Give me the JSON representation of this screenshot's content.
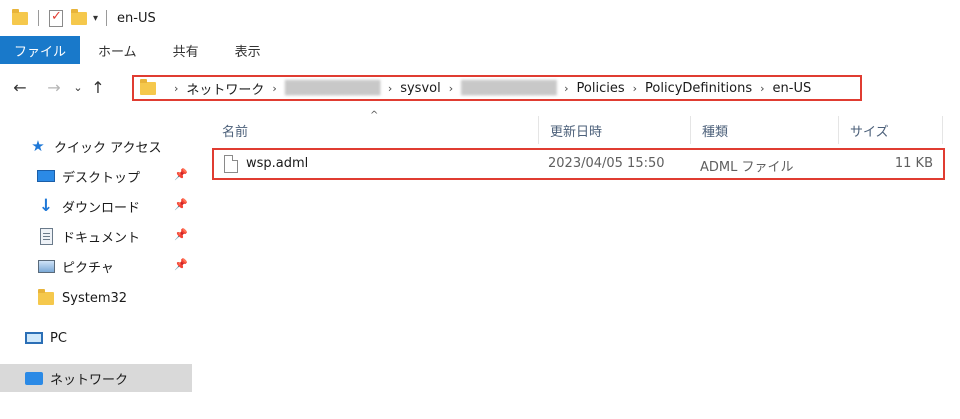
{
  "window": {
    "title": "en-US"
  },
  "quick_access_toolbar": {
    "icons": [
      "folder-icon",
      "properties-icon",
      "new-folder-icon",
      "customize-dropdown-icon"
    ]
  },
  "ribbon": {
    "tabs": [
      "ファイル",
      "ホーム",
      "共有",
      "表示"
    ]
  },
  "navigation": {
    "back": "←",
    "forward": "→",
    "recent": "⌄",
    "up": "↑"
  },
  "address": {
    "crumbs": [
      "ネットワーク",
      "",
      "sysvol",
      "",
      "Policies",
      "PolicyDefinitions",
      "en-US"
    ],
    "redacted_indexes": [
      1,
      3
    ],
    "highlight_color": "#e03c31"
  },
  "sidebar": {
    "quick_access": "クイック アクセス",
    "items": [
      {
        "label": "デスクトップ",
        "icon": "desktop-icon",
        "pinned": true
      },
      {
        "label": "ダウンロード",
        "icon": "download-icon",
        "pinned": true
      },
      {
        "label": "ドキュメント",
        "icon": "documents-icon",
        "pinned": true
      },
      {
        "label": "ピクチャ",
        "icon": "pictures-icon",
        "pinned": true
      },
      {
        "label": "System32",
        "icon": "folder-icon",
        "pinned": false
      }
    ],
    "pc": "PC",
    "network": "ネットワーク"
  },
  "file_list": {
    "columns": [
      "名前",
      "更新日時",
      "種類",
      "サイズ"
    ],
    "sort_column": "名前",
    "rows": [
      {
        "name": "wsp.adml",
        "modified": "2023/04/05 15:50",
        "type": "ADML ファイル",
        "size": "11 KB"
      }
    ]
  },
  "colors": {
    "accent": "#1979ca",
    "highlight": "#e03c31",
    "folder": "#f5c84c"
  }
}
